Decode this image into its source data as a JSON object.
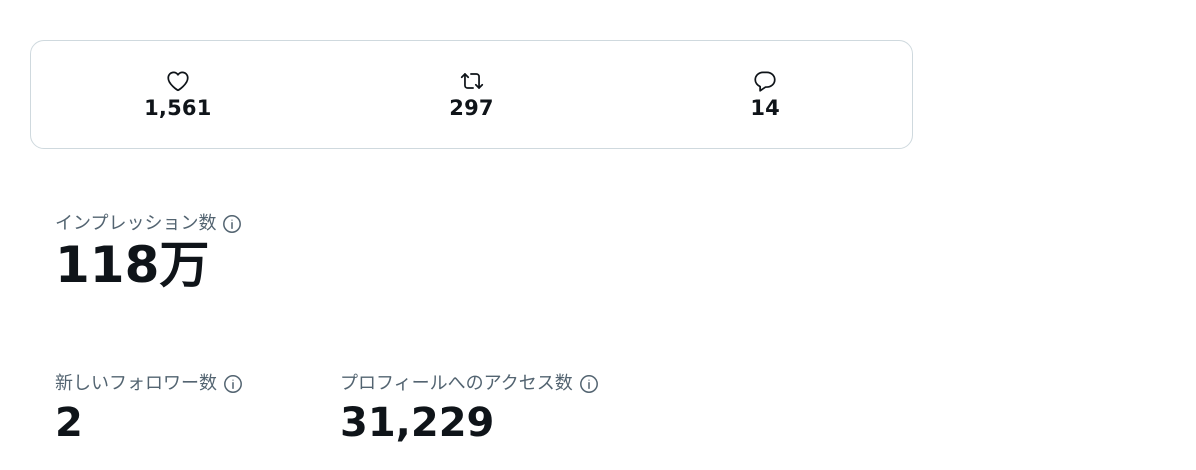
{
  "engagement": [
    {
      "icon": "heart-icon",
      "value": "1,561"
    },
    {
      "icon": "retweet-icon",
      "value": "297"
    },
    {
      "icon": "reply-icon",
      "value": "14"
    }
  ],
  "impressions": {
    "label": "インプレッション数",
    "value": "118万"
  },
  "new_followers": {
    "label": "新しいフォロワー数",
    "value": "2"
  },
  "profile_visits": {
    "label": "プロフィールへのアクセス数",
    "value": "31,229"
  }
}
